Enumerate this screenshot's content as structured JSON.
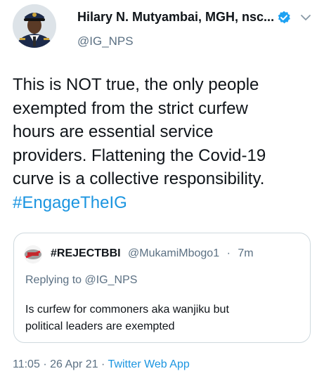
{
  "author": {
    "name": "Hilary N. Mutyambai, MGH, nsc...",
    "handle": "@IG_NPS"
  },
  "tweet": {
    "lines": [
      "This is NOT true, the only people",
      "exempted from the strict curfew",
      "hours are essential service",
      "providers. Flattening the Covid-19",
      "curve is a collective responsibility."
    ],
    "hashtag": "#EngageTheIG"
  },
  "quote": {
    "name": "#REJECTBBI",
    "handle": "@MukamiMbogo1",
    "separator": "·",
    "time": "7m",
    "replying_to": "Replying to @IG_NPS",
    "lines": [
      "Is curfew for commoners aka wanjiku but",
      "political leaders are exempted"
    ]
  },
  "footer": {
    "time": "11:05",
    "separator1": "·",
    "date": "26 Apr 21",
    "separator2": "·",
    "source": "Twitter Web App"
  },
  "icons": {
    "verified": "verified-badge-icon",
    "more": "chevron-down-icon"
  },
  "colors": {
    "accent": "#1b95e0",
    "secondary_text": "#5b7083",
    "border": "#cfd9de"
  }
}
